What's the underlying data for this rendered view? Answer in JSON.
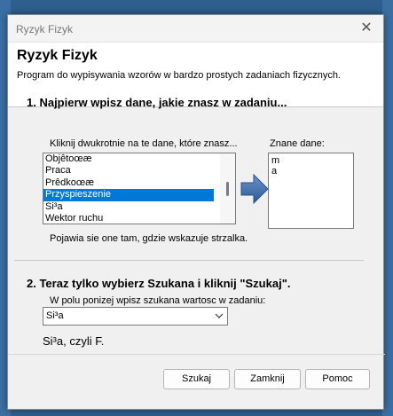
{
  "window": {
    "title": "Ryzyk Fizyk",
    "close_glyph": "✕"
  },
  "header": {
    "title": "Ryzyk Fizyk",
    "description": "Program do wypisywania wzorów w bardzo prostych zadaniach fizycznych."
  },
  "step1": {
    "title": "1. Najpierw wpisz dane, jakie znasz w zadaniu...",
    "list_label": "Kliknij dwukrotnie na te dane, które znasz...",
    "items": [
      "Objêtoœæ",
      "Praca",
      "Prêdkoœæ",
      "Przyspieszenie",
      "Si³a",
      "Wektor ruchu"
    ],
    "selected_item": "Przyspieszenie",
    "known_label": "Znane dane:",
    "known_items": [
      "m",
      "a"
    ],
    "hint": "Pojawia sie one tam, gdzie wskazuje strzalka."
  },
  "step2": {
    "title": "2. Teraz tylko wybierz Szukana i kliknij \"Szukaj\".",
    "field_label": "W polu ponizej wpisz szukana wartosc w zadaniu:",
    "combo_value": "Si³a",
    "result": "Si³a, czyli F."
  },
  "buttons": {
    "search": "Szukaj",
    "close": "Zamknij",
    "help": "Pomoc"
  },
  "colors": {
    "selection": "#0078d7",
    "arrow": "#3d6aa6"
  }
}
